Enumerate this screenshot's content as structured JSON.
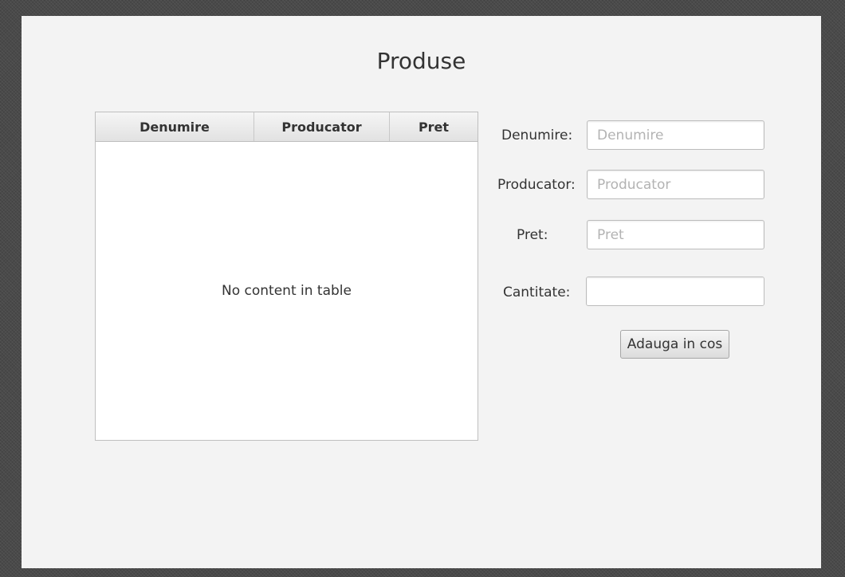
{
  "window": {
    "title": "Produse"
  },
  "table": {
    "columns": [
      "Denumire",
      "Producator",
      "Pret"
    ],
    "rows": [],
    "empty_text": "No content in table"
  },
  "form": {
    "denumire": {
      "label": "Denumire:",
      "value": "",
      "placeholder": "Denumire"
    },
    "producator": {
      "label": "Producator:",
      "value": "",
      "placeholder": "Producator"
    },
    "pret": {
      "label": "Pret:",
      "value": "",
      "placeholder": "Pret"
    },
    "cantitate": {
      "label": "Cantitate:",
      "value": ""
    },
    "add_button_label": "Adauga in cos"
  },
  "icons": {
    "spinner_up": "triangle-up-icon",
    "spinner_down": "triangle-down-icon"
  },
  "colors": {
    "page_background": "#4a4a4a",
    "window_background": "#f3f3f3",
    "text": "#333333",
    "placeholder": "#b3b3b3"
  }
}
